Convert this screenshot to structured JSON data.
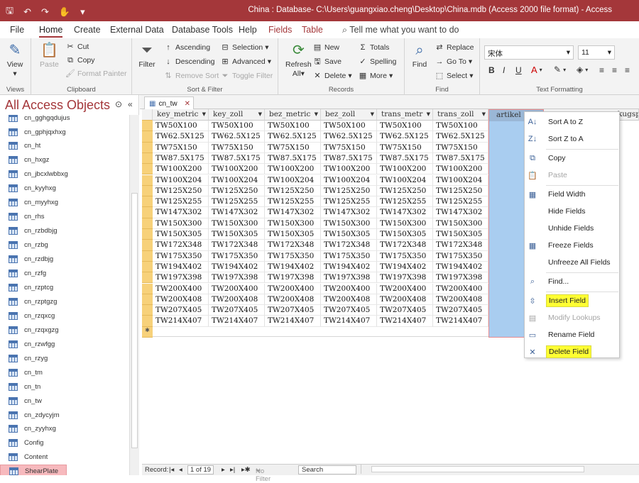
{
  "window": {
    "title": "China : Database- C:\\Users\\guangxiao.cheng\\Desktop\\China.mdb (Access 2000 file format)  -  Access"
  },
  "ribbon_tabs": [
    "File",
    "Home",
    "Create",
    "External Data",
    "Database Tools",
    "Help",
    "Fields",
    "Table"
  ],
  "active_tab": "Home",
  "tell_me": "Tell me what you want to do",
  "ribbon": {
    "views": {
      "view": "View",
      "label": "Views"
    },
    "clipboard": {
      "paste": "Paste",
      "cut": "Cut",
      "copy": "Copy",
      "format_painter": "Format Painter",
      "label": "Clipboard"
    },
    "sort_filter": {
      "filter": "Filter",
      "ascending": "Ascending",
      "descending": "Descending",
      "remove_sort": "Remove Sort",
      "selection": "Selection",
      "advanced": "Advanced",
      "toggle_filter": "Toggle Filter",
      "label": "Sort & Filter"
    },
    "records": {
      "refresh": "Refresh",
      "refresh_all": "All",
      "new": "New",
      "save": "Save",
      "delete": "Delete",
      "totals": "Totals",
      "spelling": "Spelling",
      "more": "More",
      "label": "Records"
    },
    "find": {
      "find": "Find",
      "replace": "Replace",
      "goto": "Go To",
      "select": "Select",
      "label": "Find"
    },
    "text_formatting": {
      "font": "宋体",
      "size": "11",
      "label": "Text Formatting"
    }
  },
  "nav": {
    "title": "All Access Objects",
    "items": [
      "cn_gphjqxhxg",
      "cn_ht",
      "cn_hxgz",
      "cn_jbcxlwbbxg",
      "cn_kyyhxg",
      "cn_myyhxg",
      "cn_rhs",
      "cn_rzbdbjg",
      "cn_rzbg",
      "cn_rzdbjg",
      "cn_rzfg",
      "cn_rzptcg",
      "cn_rzptgzg",
      "cn_rzqxcg",
      "cn_rzqxgzg",
      "cn_rzwfgg",
      "cn_rzyg",
      "cn_tm",
      "cn_tn",
      "cn_tw",
      "cn_zdycyjm",
      "cn_zyyhxg",
      "Config",
      "Content",
      "ShearPlate"
    ],
    "partial_item": "cn_gghgqdujus",
    "selected": "ShearPlate"
  },
  "document_tab": "cn_tw",
  "table": {
    "columns": [
      "key_metric",
      "key_zoll",
      "bez_metric",
      "bez_zoll",
      "trans_metr",
      "trans_zoll",
      "artikel",
      "kugspr"
    ],
    "rows": [
      [
        "TW50X100",
        "TW50X100",
        "TW50X100",
        "TW50X100",
        "TW50X100",
        "TW50X100"
      ],
      [
        "TW62.5X125",
        "TW62.5X125",
        "TW62.5X125",
        "TW62.5X125",
        "TW62.5X125",
        "TW62.5X125"
      ],
      [
        "TW75X150",
        "TW75X150",
        "TW75X150",
        "TW75X150",
        "TW75X150",
        "TW75X150"
      ],
      [
        "TW87.5X175",
        "TW87.5X175",
        "TW87.5X175",
        "TW87.5X175",
        "TW87.5X175",
        "TW87.5X175"
      ],
      [
        "TW100X200",
        "TW100X200",
        "TW100X200",
        "TW100X200",
        "TW100X200",
        "TW100X200"
      ],
      [
        "TW100X204",
        "TW100X204",
        "TW100X204",
        "TW100X204",
        "TW100X204",
        "TW100X204"
      ],
      [
        "TW125X250",
        "TW125X250",
        "TW125X250",
        "TW125X250",
        "TW125X250",
        "TW125X250"
      ],
      [
        "TW125X255",
        "TW125X255",
        "TW125X255",
        "TW125X255",
        "TW125X255",
        "TW125X255"
      ],
      [
        "TW147X302",
        "TW147X302",
        "TW147X302",
        "TW147X302",
        "TW147X302",
        "TW147X302"
      ],
      [
        "TW150X300",
        "TW150X300",
        "TW150X300",
        "TW150X300",
        "TW150X300",
        "TW150X300"
      ],
      [
        "TW150X305",
        "TW150X305",
        "TW150X305",
        "TW150X305",
        "TW150X305",
        "TW150X305"
      ],
      [
        "TW172X348",
        "TW172X348",
        "TW172X348",
        "TW172X348",
        "TW172X348",
        "TW172X348"
      ],
      [
        "TW175X350",
        "TW175X350",
        "TW175X350",
        "TW175X350",
        "TW175X350",
        "TW175X350"
      ],
      [
        "TW194X402",
        "TW194X402",
        "TW194X402",
        "TW194X402",
        "TW194X402",
        "TW194X402"
      ],
      [
        "TW197X398",
        "TW197X398",
        "TW197X398",
        "TW197X398",
        "TW197X398",
        "TW197X398"
      ],
      [
        "TW200X400",
        "TW200X400",
        "TW200X400",
        "TW200X400",
        "TW200X400",
        "TW200X400"
      ],
      [
        "TW200X408",
        "TW200X408",
        "TW200X408",
        "TW200X408",
        "TW200X408",
        "TW200X408"
      ],
      [
        "TW207X405",
        "TW207X405",
        "TW207X405",
        "TW207X405",
        "TW207X405",
        "TW207X405"
      ],
      [
        "TW214X407",
        "TW214X407",
        "TW214X407",
        "TW214X407",
        "TW214X407",
        "TW214X407"
      ]
    ]
  },
  "context_menu": {
    "items": [
      {
        "label": "Sort A to Z",
        "icon": "sort-az-icon",
        "glyph": "A↓",
        "disabled": false,
        "highlight": false
      },
      {
        "label": "Sort Z to A",
        "icon": "sort-za-icon",
        "glyph": "Z↓",
        "disabled": false,
        "highlight": false
      },
      {
        "sep": true
      },
      {
        "label": "Copy",
        "icon": "copy-icon",
        "glyph": "⧉",
        "disabled": false,
        "highlight": false
      },
      {
        "label": "Paste",
        "icon": "paste-icon",
        "glyph": "📋",
        "disabled": true,
        "highlight": false
      },
      {
        "sep": true
      },
      {
        "label": "Field Width",
        "icon": "field-width-icon",
        "glyph": "▦",
        "disabled": false,
        "highlight": false
      },
      {
        "label": "Hide Fields",
        "icon": "",
        "glyph": "",
        "disabled": false,
        "highlight": false
      },
      {
        "label": "Unhide Fields",
        "icon": "",
        "glyph": "",
        "disabled": false,
        "highlight": false
      },
      {
        "label": "Freeze Fields",
        "icon": "freeze-icon",
        "glyph": "▦",
        "disabled": false,
        "highlight": false
      },
      {
        "label": "Unfreeze All Fields",
        "icon": "",
        "glyph": "",
        "disabled": false,
        "highlight": false
      },
      {
        "sep": true
      },
      {
        "label": "Find...",
        "icon": "search-icon",
        "glyph": "⌕",
        "disabled": false,
        "highlight": false
      },
      {
        "sep": true
      },
      {
        "label": "Insert Field",
        "icon": "insert-field-icon",
        "glyph": "⇳",
        "disabled": false,
        "highlight": true
      },
      {
        "label": "Modify Lookups",
        "icon": "modify-lookups-icon",
        "glyph": "▤",
        "disabled": true,
        "highlight": false
      },
      {
        "label": "Rename Field",
        "icon": "rename-field-icon",
        "glyph": "▭",
        "disabled": false,
        "highlight": false
      },
      {
        "label": "Delete Field",
        "icon": "delete-field-icon",
        "glyph": "✕",
        "disabled": false,
        "highlight": true
      }
    ]
  },
  "status": {
    "record_label": "Record:",
    "record_of": "1 of 19",
    "no_filter": "No Filter",
    "search": "Search"
  },
  "colors": {
    "accent": "#a4373a",
    "selected_column": "#a9cdf0",
    "highlight": "#ffff33",
    "row_selector": "#f7d17a"
  }
}
